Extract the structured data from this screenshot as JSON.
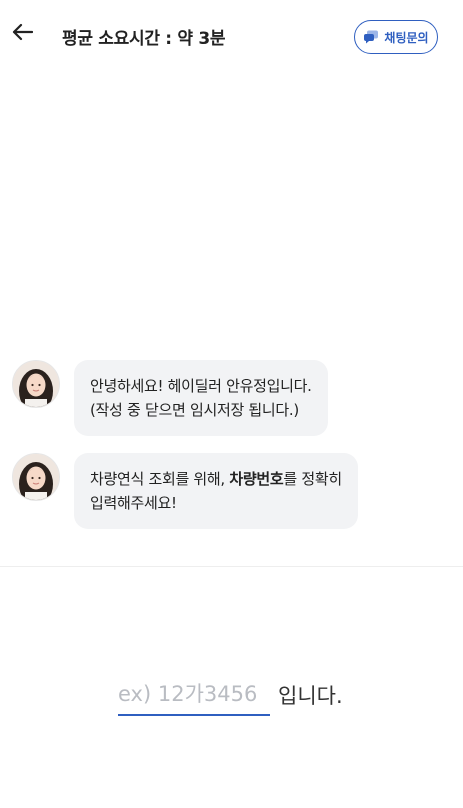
{
  "header": {
    "back_icon": "arrow-left-icon",
    "title": "평균 소요시간 : 약 3분",
    "chat_button_label": "채팅문의",
    "chat_button_icon": "chat-bubbles-icon",
    "accent_color": "#2f5fc0"
  },
  "messages": [
    {
      "sender_avatar": "dealer-avatar",
      "lines": [
        "안녕하세요! 헤이딜러 안유정입니다.",
        "(작성 중 닫으면 임시저장 됩니다.)"
      ]
    },
    {
      "sender_avatar": "dealer-avatar",
      "line1_before": "차량연식 조회를 위해, ",
      "line1_bold": "차량번호",
      "line1_after": "를 정확히",
      "line2": "입력해주세요!"
    }
  ],
  "plate_input": {
    "placeholder": "ex) 12가3456",
    "value": "",
    "suffix": "입니다."
  }
}
